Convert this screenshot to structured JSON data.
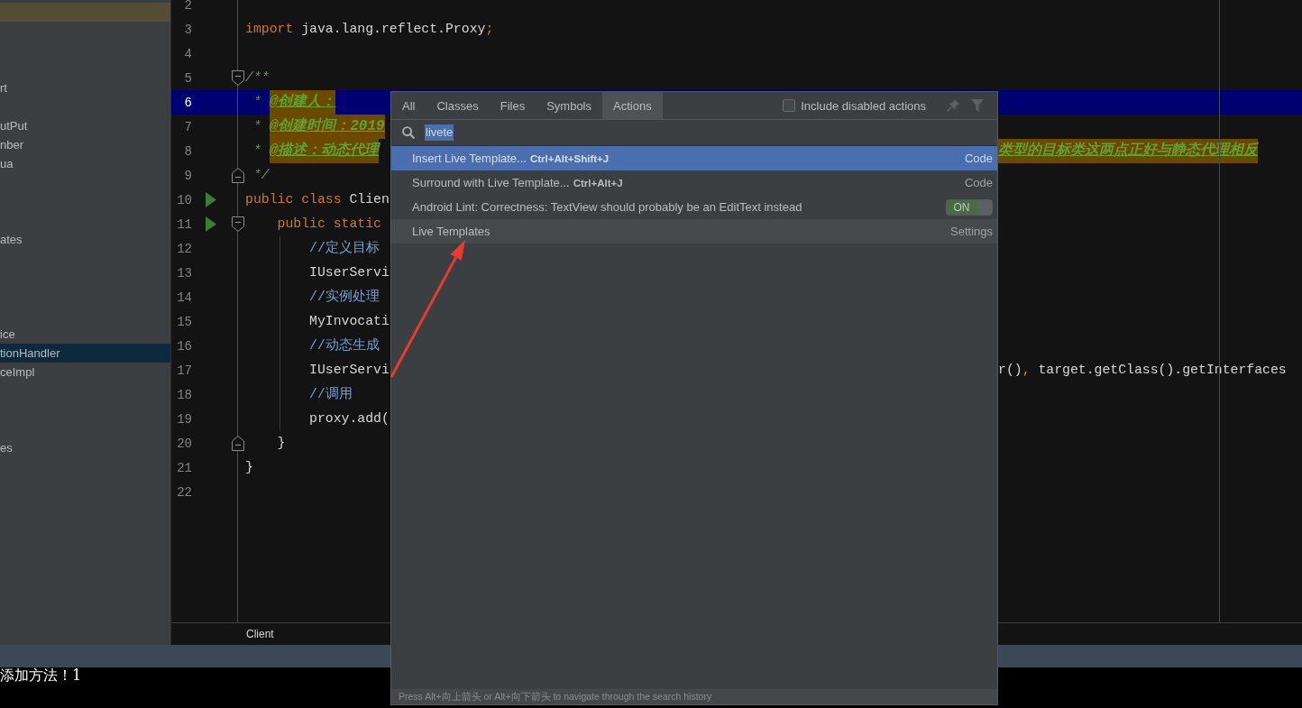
{
  "project_tree": {
    "rows": [
      {
        "selected": false,
        "highlighted": true
      },
      {
        "selected": false,
        "highlighted": false
      },
      {
        "selected": false,
        "highlighted": false
      },
      {
        "selected": false,
        "highlighted": false
      },
      {
        "label": "rt",
        "selected": false,
        "highlighted": false
      },
      {
        "selected": false,
        "highlighted": false
      },
      {
        "label": "utPut",
        "selected": false,
        "highlighted": false
      },
      {
        "label": "nber",
        "selected": false,
        "highlighted": false
      },
      {
        "label": "ua",
        "selected": false,
        "highlighted": false
      },
      {
        "selected": false,
        "highlighted": false
      },
      {
        "selected": false,
        "highlighted": false
      },
      {
        "selected": false,
        "highlighted": false
      },
      {
        "label": "ates",
        "selected": false,
        "highlighted": false
      },
      {
        "selected": false,
        "highlighted": false
      },
      {
        "selected": false,
        "highlighted": false
      },
      {
        "selected": false,
        "highlighted": false
      },
      {
        "selected": false,
        "highlighted": false
      },
      {
        "label": "ice",
        "selected": false,
        "highlighted": false
      },
      {
        "label": "tionHandler",
        "selected": true,
        "highlighted": false
      },
      {
        "label": "ceImpl",
        "selected": false,
        "highlighted": false
      },
      {
        "selected": false,
        "highlighted": false
      },
      {
        "selected": false,
        "highlighted": false
      },
      {
        "selected": false,
        "highlighted": false
      },
      {
        "label": "es",
        "selected": false,
        "highlighted": false
      }
    ]
  },
  "editor": {
    "lines": [
      {
        "number": "2",
        "kind": "plain",
        "current": false,
        "runnable": false
      },
      {
        "number": "3",
        "kind": "plain",
        "current": false,
        "runnable": false,
        "code": [
          {
            "kind": "keyword",
            "text": "import"
          },
          {
            "kind": "plain",
            "text": " java.lang.reflect.Proxy"
          },
          {
            "kind": "keyword",
            "text": ";"
          }
        ]
      },
      {
        "number": "4",
        "kind": "plain",
        "current": false,
        "runnable": false
      },
      {
        "number": "5",
        "kind": "fold-start",
        "current": false,
        "runnable": false,
        "code": [
          {
            "kind": "doc",
            "text": "/**"
          }
        ]
      },
      {
        "number": "6",
        "kind": "plain",
        "current": true,
        "runnable": false,
        "code": [
          {
            "kind": "doc",
            "text": " * "
          },
          {
            "kind": "doc-tag",
            "text": "@创建人："
          }
        ]
      },
      {
        "number": "7",
        "kind": "plain",
        "current": false,
        "runnable": false,
        "code": [
          {
            "kind": "doc",
            "text": " * "
          },
          {
            "kind": "doc-tag",
            "text": "@创建时间：2019"
          }
        ]
      },
      {
        "number": "8",
        "kind": "plain",
        "current": false,
        "runnable": false,
        "code": [
          {
            "kind": "doc",
            "text": " * "
          },
          {
            "kind": "doc-tag",
            "text": "@描述：动态代理"
          }
        ],
        "code_right": [
          {
            "kind": "doc-tag",
            "text": "类型的目标类这两点正好与静态代理相反"
          }
        ]
      },
      {
        "number": "9",
        "kind": "fold-end",
        "current": false,
        "runnable": false,
        "code": [
          {
            "kind": "doc",
            "text": " */"
          }
        ]
      },
      {
        "number": "10",
        "kind": "plain",
        "current": false,
        "runnable": true,
        "code": [
          {
            "kind": "keyword",
            "text": "public class "
          },
          {
            "kind": "plain",
            "text": "Clien"
          }
        ]
      },
      {
        "number": "11",
        "kind": "fold-start",
        "current": false,
        "runnable": true,
        "code": [
          {
            "kind": "keyword",
            "text": "    public static"
          }
        ]
      },
      {
        "number": "12",
        "kind": "plain",
        "current": false,
        "runnable": false,
        "code": [
          {
            "kind": "comment",
            "text": "        //定义目标"
          }
        ]
      },
      {
        "number": "13",
        "kind": "plain",
        "current": false,
        "runnable": false,
        "code": [
          {
            "kind": "plain",
            "text": "        IUserServi"
          }
        ]
      },
      {
        "number": "14",
        "kind": "plain",
        "current": false,
        "runnable": false,
        "code": [
          {
            "kind": "comment",
            "text": "        //实例处理"
          }
        ]
      },
      {
        "number": "15",
        "kind": "plain",
        "current": false,
        "runnable": false,
        "code": [
          {
            "kind": "plain",
            "text": "        MyInvocati"
          }
        ]
      },
      {
        "number": "16",
        "kind": "plain",
        "current": false,
        "runnable": false,
        "code": [
          {
            "kind": "comment",
            "text": "        //动态生成"
          }
        ]
      },
      {
        "number": "17",
        "kind": "plain",
        "current": false,
        "runnable": false,
        "code": [
          {
            "kind": "plain",
            "text": "        IUserServi"
          }
        ],
        "code_right": [
          {
            "kind": "plain",
            "text": "r()"
          },
          {
            "kind": "keyword",
            "text": ","
          },
          {
            "kind": "plain",
            "text": " target.getClass().getInterfaces"
          }
        ]
      },
      {
        "number": "18",
        "kind": "plain",
        "current": false,
        "runnable": false,
        "code": [
          {
            "kind": "comment",
            "text": "        //调用"
          }
        ]
      },
      {
        "number": "19",
        "kind": "plain",
        "current": false,
        "runnable": false,
        "code": [
          {
            "kind": "plain",
            "text": "        proxy.add("
          }
        ]
      },
      {
        "number": "20",
        "kind": "fold-end",
        "current": false,
        "runnable": false,
        "code": [
          {
            "kind": "plain",
            "text": "    }"
          }
        ]
      },
      {
        "number": "21",
        "kind": "plain",
        "current": false,
        "runnable": false,
        "code": [
          {
            "kind": "plain",
            "text": "}"
          }
        ]
      },
      {
        "number": "22",
        "kind": "plain",
        "current": false,
        "runnable": false
      }
    ],
    "breadcrumb": "Client"
  },
  "run_console": {
    "output": "添加方法！1"
  },
  "popup": {
    "tabs": [
      {
        "label": "All",
        "selected": false
      },
      {
        "label": "Classes",
        "selected": false
      },
      {
        "label": "Files",
        "selected": false
      },
      {
        "label": "Symbols",
        "selected": false
      },
      {
        "label": "Actions",
        "selected": true
      }
    ],
    "include_disabled": {
      "label": "Include disabled actions",
      "checked": false
    },
    "search": {
      "value": "livete",
      "value_selected": true
    },
    "results": [
      {
        "kind": "action",
        "label": "Insert Live Template...",
        "shortcut": "Ctrl+Alt+Shift+J",
        "group": "Code",
        "selected": true
      },
      {
        "kind": "action",
        "label": "Surround with Live Template...",
        "shortcut": "Ctrl+Alt+J",
        "group": "Code",
        "selected": false
      },
      {
        "kind": "option",
        "label": "Android Lint: Correctness: TextView should probably be an EditText instead",
        "toggle": "ON",
        "on": true,
        "selected": false
      },
      {
        "kind": "setting",
        "label": "Live Templates",
        "group": "Settings",
        "selected": false
      }
    ],
    "hint": "Press Alt+向上箭头 or Alt+向下箭头 to navigate through the search history"
  }
}
